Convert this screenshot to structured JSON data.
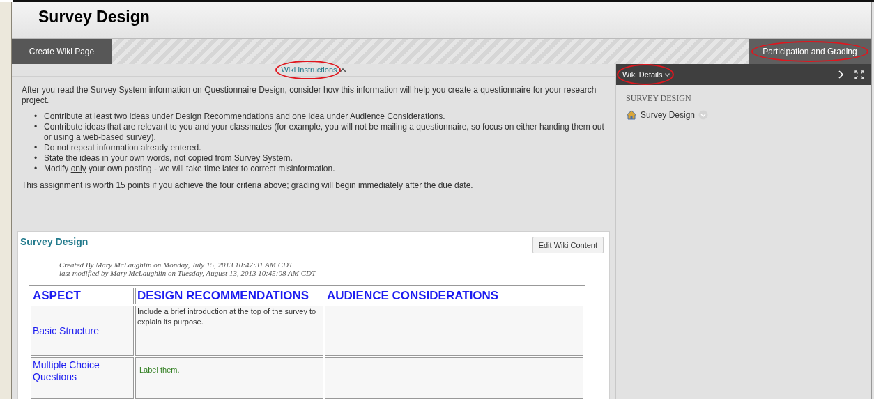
{
  "page": {
    "title": "Survey Design"
  },
  "action_bar": [
    {
      "label": "Create Wiki Page",
      "circled": false
    },
    {
      "label": "Participation and Grading",
      "circled": true
    }
  ],
  "instructions_toggle": {
    "label": "Wiki Instructions",
    "expanded": true,
    "circled": true
  },
  "instructions": {
    "intro": "After you read the Survey System information on Questionnaire Design, consider how this information will help you create a questionnaire for your research project.",
    "bullets": [
      {
        "marker": "•",
        "segments": [
          {
            "text": "Contribute at least two ideas under Design Recommendations and one idea under Audience Considerations."
          }
        ]
      },
      {
        "marker": "•",
        "segments": [
          {
            "text": "Contribute ideas that are relevant to you and your classmates (for example, you will not be mailing a questionnaire, so focus on either handing them out or using a web-based survey)."
          }
        ]
      },
      {
        "marker": "•",
        "segments": [
          {
            "text": "Do not repeat information already entered."
          }
        ]
      },
      {
        "marker": "•",
        "segments": [
          {
            "text": "State the ideas in your own words, not copied from Survey System."
          }
        ]
      },
      {
        "marker": "•",
        "segments": [
          {
            "text": "Modify ",
            "underline": false
          },
          {
            "text": "only",
            "underline": true
          },
          {
            "text": " your own posting - we will take time later to correct misinformation.",
            "underline": false
          }
        ]
      }
    ],
    "closing": "This assignment is worth 15 points if you achieve the four criteria above; grading will begin immediately after the due date."
  },
  "wiki_page": {
    "title": "Survey Design",
    "edit_button": "Edit Wiki Content",
    "meta": [
      "Created By Mary McLaughlin on Monday, July 15, 2013 10:47:31 AM CDT",
      "last modified by Mary McLaughlin on Tuesday, August 13, 2013 10:45:08 AM CDT"
    ],
    "table": {
      "columns": [
        "ASPECT",
        "DESIGN RECOMMENDATIONS",
        "AUDIENCE CONSIDERATIONS"
      ],
      "rows": [
        {
          "aspect": "Basic Structure",
          "recommendation": "Include a brief introduction at the top of the survey to explain its purpose.",
          "kind": "plain"
        },
        {
          "aspect": "Multiple Choice Questions",
          "recommendation": "Label them.",
          "kind": "highlighted"
        }
      ]
    }
  },
  "sidebar": {
    "header": {
      "label": "Wiki Details",
      "circled": true
    },
    "section_title": "SURVEY DESIGN",
    "pages": [
      {
        "label": "Survey Design"
      }
    ]
  }
}
